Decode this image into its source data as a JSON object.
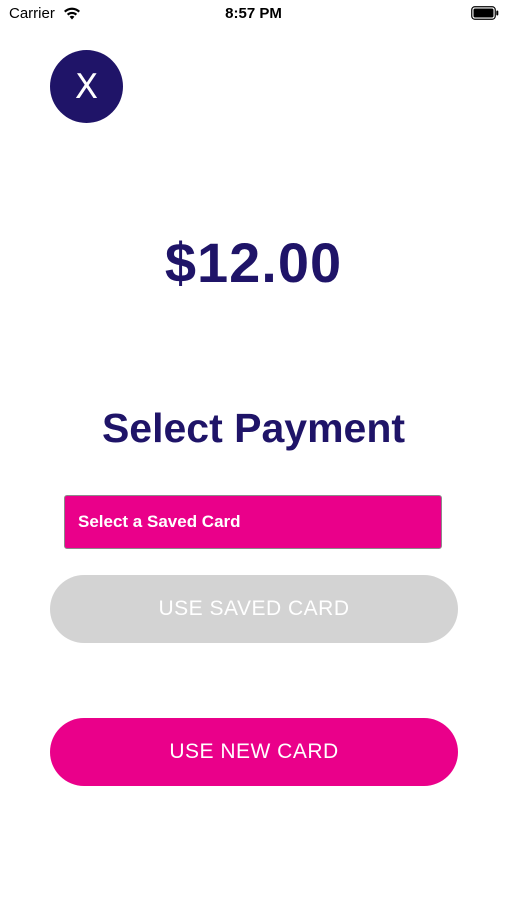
{
  "status_bar": {
    "carrier": "Carrier",
    "time": "8:57 PM",
    "wifi_icon": "wifi-icon",
    "battery_icon": "battery-icon"
  },
  "close_button": {
    "label": "X"
  },
  "payment": {
    "amount": "$12.00",
    "title": "Select Payment",
    "saved_card_select": "Select a Saved Card",
    "use_saved_card": "USE SAVED CARD",
    "use_new_card": "USE NEW CARD"
  },
  "colors": {
    "primary_navy": "#1f1468",
    "accent_pink": "#ea008a",
    "disabled_gray": "#d3d3d3"
  }
}
